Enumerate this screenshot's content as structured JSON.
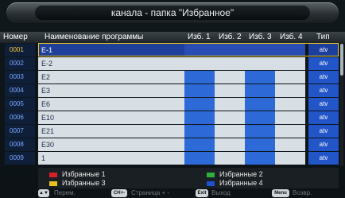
{
  "title": "канала - папка \"Избранное\"",
  "header": {
    "number": "Номер",
    "program_name": "Наименование программы",
    "fav1": "Изб. 1",
    "fav2": "Изб. 2",
    "fav3": "Изб. 3",
    "fav4": "Изб. 4",
    "type": "Тип"
  },
  "rows": [
    {
      "number": "0001",
      "name": "E-1",
      "type": "atv"
    },
    {
      "number": "0002",
      "name": "E-2",
      "type": "atv"
    },
    {
      "number": "0003",
      "name": "E2",
      "type": "atv"
    },
    {
      "number": "0004",
      "name": "E3",
      "type": "atv"
    },
    {
      "number": "0005",
      "name": "E6",
      "type": "atv"
    },
    {
      "number": "0006",
      "name": "E10",
      "type": "atv"
    },
    {
      "number": "0007",
      "name": "E21",
      "type": "atv"
    },
    {
      "number": "0008",
      "name": "E30",
      "type": "atv"
    },
    {
      "number": "0009",
      "name": "1",
      "type": "atv"
    }
  ],
  "legend": {
    "fav1": "Избранные 1",
    "fav2": "Избранные 2",
    "fav3": "Избранные 3",
    "fav4": "Избранные 4",
    "colors": {
      "fav1": "#d8202a",
      "fav2": "#2fb03a",
      "fav3": "#e8c020",
      "fav4": "#1e50d0"
    }
  },
  "footer": {
    "move_key": "▲▼",
    "move_label": "Перем.",
    "page_key": "CH+-",
    "page_label": "Страница + -",
    "exit_key": "Exit",
    "exit_label": "Выход",
    "menu_key": "Menu",
    "menu_label": "Возвр."
  },
  "colors": {
    "accent": "#2255c8",
    "selection_border": "#f0c820",
    "number_text": "#79a9ff"
  }
}
